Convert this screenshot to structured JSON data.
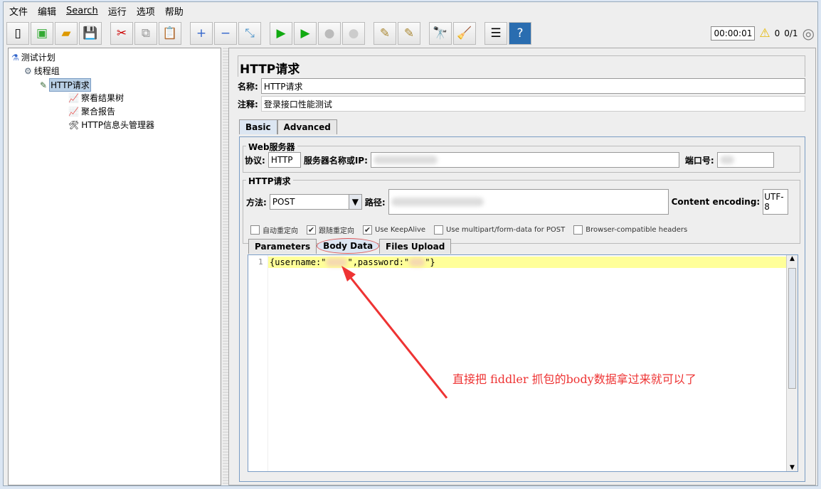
{
  "menu": [
    "文件",
    "编辑",
    "Search",
    "运行",
    "选项",
    "帮助"
  ],
  "toolbar": {
    "icons": [
      "new-icon",
      "templates-icon",
      "open-icon",
      "save-icon",
      "cut-icon",
      "copy-icon",
      "paste-icon",
      "expand-icon",
      "collapse-icon",
      "toggle-icon",
      "start-icon",
      "start-no-pause-icon",
      "stop-icon",
      "shutdown-icon",
      "clear-icon",
      "clear-all-icon",
      "search-icon",
      "reset-search-icon",
      "function-helper-icon",
      "help-icon"
    ]
  },
  "status": {
    "timer": "00:00:01",
    "warnings": "0",
    "threads": "0/1"
  },
  "tree": [
    "测试计划",
    "线程组",
    "HTTP请求",
    "察看结果树",
    "聚合报告",
    "HTTP信息头管理器"
  ],
  "panel": {
    "title": "HTTP请求",
    "name_label": "名称:",
    "name_value": "HTTP请求",
    "comment_label": "注释:",
    "comment_value": "登录接口性能测试",
    "tabs": [
      "Basic",
      "Advanced"
    ],
    "web_server": "Web服务器",
    "protocol_label": "协议:",
    "protocol_value": "HTTP",
    "server_label": "服务器名称或IP:",
    "port_label": "端口号:",
    "http_request": "HTTP请求",
    "method_label": "方法:",
    "method_value": "POST",
    "path_label": "路径:",
    "encoding_label": "Content encoding:",
    "encoding_value": "UTF-8",
    "checkboxes": [
      {
        "label": "自动重定向",
        "checked": false
      },
      {
        "label": "跟随重定向",
        "checked": true
      },
      {
        "label": "Use KeepAlive",
        "checked": true
      },
      {
        "label": "Use multipart/form-data for POST",
        "checked": false
      },
      {
        "label": "Browser-compatible headers",
        "checked": false
      }
    ],
    "subtabs": [
      "Parameters",
      "Body Data",
      "Files Upload"
    ],
    "line_no": "1",
    "body_a": "{username:\"",
    "body_b": "\",password:\"",
    "body_c": "\"}"
  },
  "annotation": "直接把  fiddler 抓包的body数据拿过来就可以了",
  "colors": {
    "annotation": "#e33333",
    "highlight": "#ffff99"
  }
}
